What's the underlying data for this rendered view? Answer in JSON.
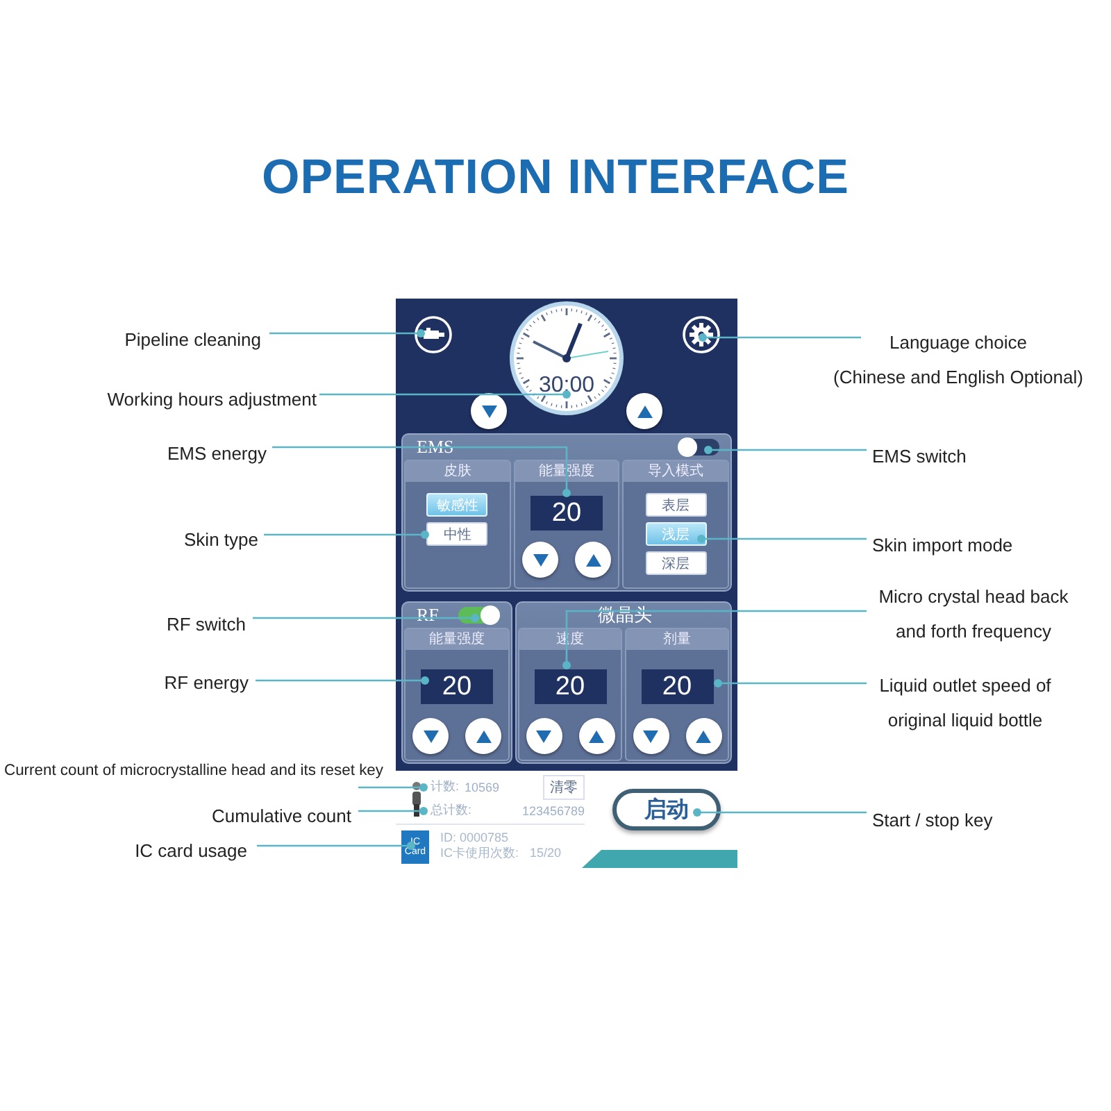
{
  "title": "OPERATION INTERFACE",
  "screen": {
    "clock": {
      "time": "30:00"
    },
    "ems": {
      "label": "EMS",
      "on": false,
      "columns": [
        {
          "kind": "options",
          "header": "皮肤",
          "options": [
            {
              "label": "敏感性",
              "selected": true
            },
            {
              "label": "中性",
              "selected": false
            }
          ]
        },
        {
          "kind": "stepper",
          "header": "能量强度",
          "value": "20"
        },
        {
          "kind": "options",
          "header": "导入模式",
          "options": [
            {
              "label": "表层",
              "selected": false
            },
            {
              "label": "浅层",
              "selected": true
            },
            {
              "label": "深层",
              "selected": false
            }
          ]
        }
      ]
    },
    "rf": {
      "label": "RF",
      "on": true,
      "columns": [
        {
          "kind": "stepper",
          "header": "能量强度",
          "value": "20"
        }
      ]
    },
    "micro": {
      "label": "微晶头",
      "columns": [
        {
          "kind": "stepper",
          "header": "速度",
          "value": "20"
        },
        {
          "kind": "stepper",
          "header": "剂量",
          "value": "20"
        }
      ]
    },
    "counter": {
      "count_label": "计数:",
      "count": "10569",
      "reset_button": "清零",
      "total_label": "总计数:",
      "total": "123456789"
    },
    "ic_card": {
      "badge": [
        "IC",
        "Card"
      ],
      "id": "ID: 0000785",
      "usage_label": "IC卡使用次数:",
      "usage": "15/20"
    },
    "start_button": "启动"
  },
  "left_callouts": [
    {
      "lines": [
        "Pipeline cleaning"
      ]
    },
    {
      "lines": [
        "Working hours adjustment"
      ]
    },
    {
      "lines": [
        "EMS energy"
      ]
    },
    {
      "lines": [
        "Skin type"
      ]
    },
    {
      "lines": [
        "RF switch"
      ]
    },
    {
      "lines": [
        "RF energy"
      ]
    },
    {
      "lines": [
        "Current count of microcrystalline head and its reset key"
      ]
    },
    {
      "lines": [
        "Cumulative count"
      ]
    },
    {
      "lines": [
        "IC card usage"
      ]
    }
  ],
  "right_callouts": [
    {
      "lines": [
        "Language choice",
        "(Chinese and English Optional)"
      ]
    },
    {
      "lines": [
        "EMS switch"
      ]
    },
    {
      "lines": [
        "Skin import mode"
      ]
    },
    {
      "lines": [
        "Micro crystal head back",
        "and forth frequency"
      ]
    },
    {
      "lines": [
        "Liquid outlet speed of",
        "original liquid bottle"
      ]
    },
    {
      "lines": [
        "Start / stop key"
      ]
    }
  ]
}
